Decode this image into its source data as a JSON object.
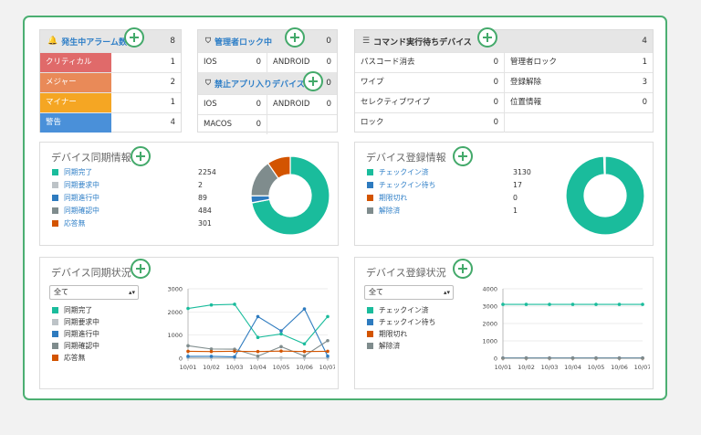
{
  "alarm": {
    "title": "発生中アラーム数",
    "count": "8",
    "rows": [
      {
        "label": "クリティカル",
        "value": "1",
        "color": "#e06a6a"
      },
      {
        "label": "メジャー",
        "value": "2",
        "color": "#e98a58"
      },
      {
        "label": "マイナー",
        "value": "1",
        "color": "#f5a623"
      },
      {
        "label": "警告",
        "value": "4",
        "color": "#4a90d9"
      }
    ]
  },
  "admin_lock": {
    "title": "管理者ロック中",
    "count": "0",
    "rows": [
      {
        "l": "IOS",
        "lv": "0",
        "r": "ANDROID",
        "rv": "0"
      }
    ]
  },
  "banned_app": {
    "title": "禁止アプリ入りデバイス",
    "count": "0",
    "rows": [
      {
        "l": "IOS",
        "lv": "0",
        "r": "ANDROID",
        "rv": "0"
      },
      {
        "l": "MACOS",
        "lv": "0",
        "r": "",
        "rv": ""
      }
    ]
  },
  "pending": {
    "title": "コマンド実行待ちデバイス",
    "count": "4",
    "rows": [
      {
        "l": "パスコード消去",
        "lv": "0",
        "r": "管理者ロック",
        "rv": "1"
      },
      {
        "l": "ワイプ",
        "lv": "0",
        "r": "登録解除",
        "rv": "3"
      },
      {
        "l": "セレクティブワイプ",
        "lv": "0",
        "r": "位置情報",
        "rv": "0"
      },
      {
        "l": "ロック",
        "lv": "0",
        "r": "",
        "rv": ""
      }
    ]
  },
  "sync_info": {
    "title": "デバイス同期情報",
    "items": [
      {
        "name": "同期完了",
        "value": "2254",
        "color": "#1abc9c"
      },
      {
        "name": "同期要求中",
        "value": "2",
        "color": "#bdc3c7"
      },
      {
        "name": "同期進行中",
        "value": "89",
        "color": "#2e7bbf"
      },
      {
        "name": "同期確認中",
        "value": "484",
        "color": "#7f8c8d"
      },
      {
        "name": "応答無",
        "value": "301",
        "color": "#d35400"
      }
    ]
  },
  "reg_info": {
    "title": "デバイス登録情報",
    "items": [
      {
        "name": "チェックイン済",
        "value": "3130",
        "color": "#1abc9c"
      },
      {
        "name": "チェックイン待ち",
        "value": "17",
        "color": "#2e7bbf"
      },
      {
        "name": "期限切れ",
        "value": "0",
        "color": "#d35400"
      },
      {
        "name": "解除済",
        "value": "1",
        "color": "#7f8c8d"
      }
    ]
  },
  "sync_status": {
    "title": "デバイス同期状況",
    "select": "全て",
    "legend": [
      {
        "name": "同期完了",
        "color": "#1abc9c"
      },
      {
        "name": "同期要求中",
        "color": "#bdc3c7"
      },
      {
        "name": "同期進行中",
        "color": "#2e7bbf"
      },
      {
        "name": "同期確認中",
        "color": "#7f8c8d"
      },
      {
        "name": "応答無",
        "color": "#d35400"
      }
    ]
  },
  "reg_status": {
    "title": "デバイス登録状況",
    "select": "全て",
    "legend": [
      {
        "name": "チェックイン済",
        "color": "#1abc9c"
      },
      {
        "name": "チェックイン待ち",
        "color": "#2e7bbf"
      },
      {
        "name": "期限切れ",
        "color": "#d35400"
      },
      {
        "name": "解除済",
        "color": "#7f8c8d"
      }
    ]
  },
  "chart_data": [
    {
      "type": "pie",
      "categories": [
        "同期完了",
        "同期要求中",
        "同期進行中",
        "同期確認中",
        "応答無"
      ],
      "values": [
        2254,
        2,
        89,
        484,
        301
      ],
      "colors": [
        "#1abc9c",
        "#bdc3c7",
        "#2e7bbf",
        "#7f8c8d",
        "#d35400"
      ],
      "title": "デバイス同期情報"
    },
    {
      "type": "pie",
      "categories": [
        "チェックイン済",
        "チェックイン待ち",
        "期限切れ",
        "解除済"
      ],
      "values": [
        3130,
        17,
        0,
        1
      ],
      "colors": [
        "#1abc9c",
        "#2e7bbf",
        "#d35400",
        "#7f8c8d"
      ],
      "title": "デバイス登録情報"
    },
    {
      "type": "line",
      "title": "デバイス同期状況",
      "x": [
        "10/01",
        "10/02",
        "10/03",
        "10/04",
        "10/05",
        "10/06",
        "10/07"
      ],
      "ylim": [
        0,
        3000
      ],
      "yticks": [
        0,
        1000,
        2000,
        3000
      ],
      "series": [
        {
          "name": "同期完了",
          "color": "#1abc9c",
          "values": [
            2150,
            2300,
            2330,
            900,
            1050,
            620,
            1800
          ]
        },
        {
          "name": "同期要求中",
          "color": "#bdc3c7",
          "values": [
            30,
            20,
            20,
            10,
            20,
            10,
            10
          ]
        },
        {
          "name": "同期進行中",
          "color": "#2e7bbf",
          "values": [
            80,
            80,
            60,
            1800,
            1180,
            2130,
            90
          ]
        },
        {
          "name": "同期確認中",
          "color": "#7f8c8d",
          "values": [
            540,
            400,
            390,
            90,
            500,
            100,
            760
          ]
        },
        {
          "name": "応答無",
          "color": "#d35400",
          "values": [
            300,
            290,
            300,
            290,
            310,
            290,
            300
          ]
        }
      ]
    },
    {
      "type": "line",
      "title": "デバイス登録状況",
      "x": [
        "10/01",
        "10/02",
        "10/03",
        "10/04",
        "10/05",
        "10/06",
        "10/07"
      ],
      "ylim": [
        0,
        4000
      ],
      "yticks": [
        0,
        1000,
        2000,
        3000,
        4000
      ],
      "series": [
        {
          "name": "チェックイン済",
          "color": "#1abc9c",
          "values": [
            3100,
            3100,
            3100,
            3100,
            3100,
            3100,
            3100
          ]
        },
        {
          "name": "チェックイン待ち",
          "color": "#2e7bbf",
          "values": [
            17,
            17,
            17,
            17,
            17,
            17,
            17
          ]
        },
        {
          "name": "期限切れ",
          "color": "#d35400",
          "values": [
            0,
            0,
            0,
            0,
            0,
            0,
            0
          ]
        },
        {
          "name": "解除済",
          "color": "#7f8c8d",
          "values": [
            1,
            1,
            1,
            1,
            1,
            1,
            1
          ]
        }
      ]
    }
  ]
}
